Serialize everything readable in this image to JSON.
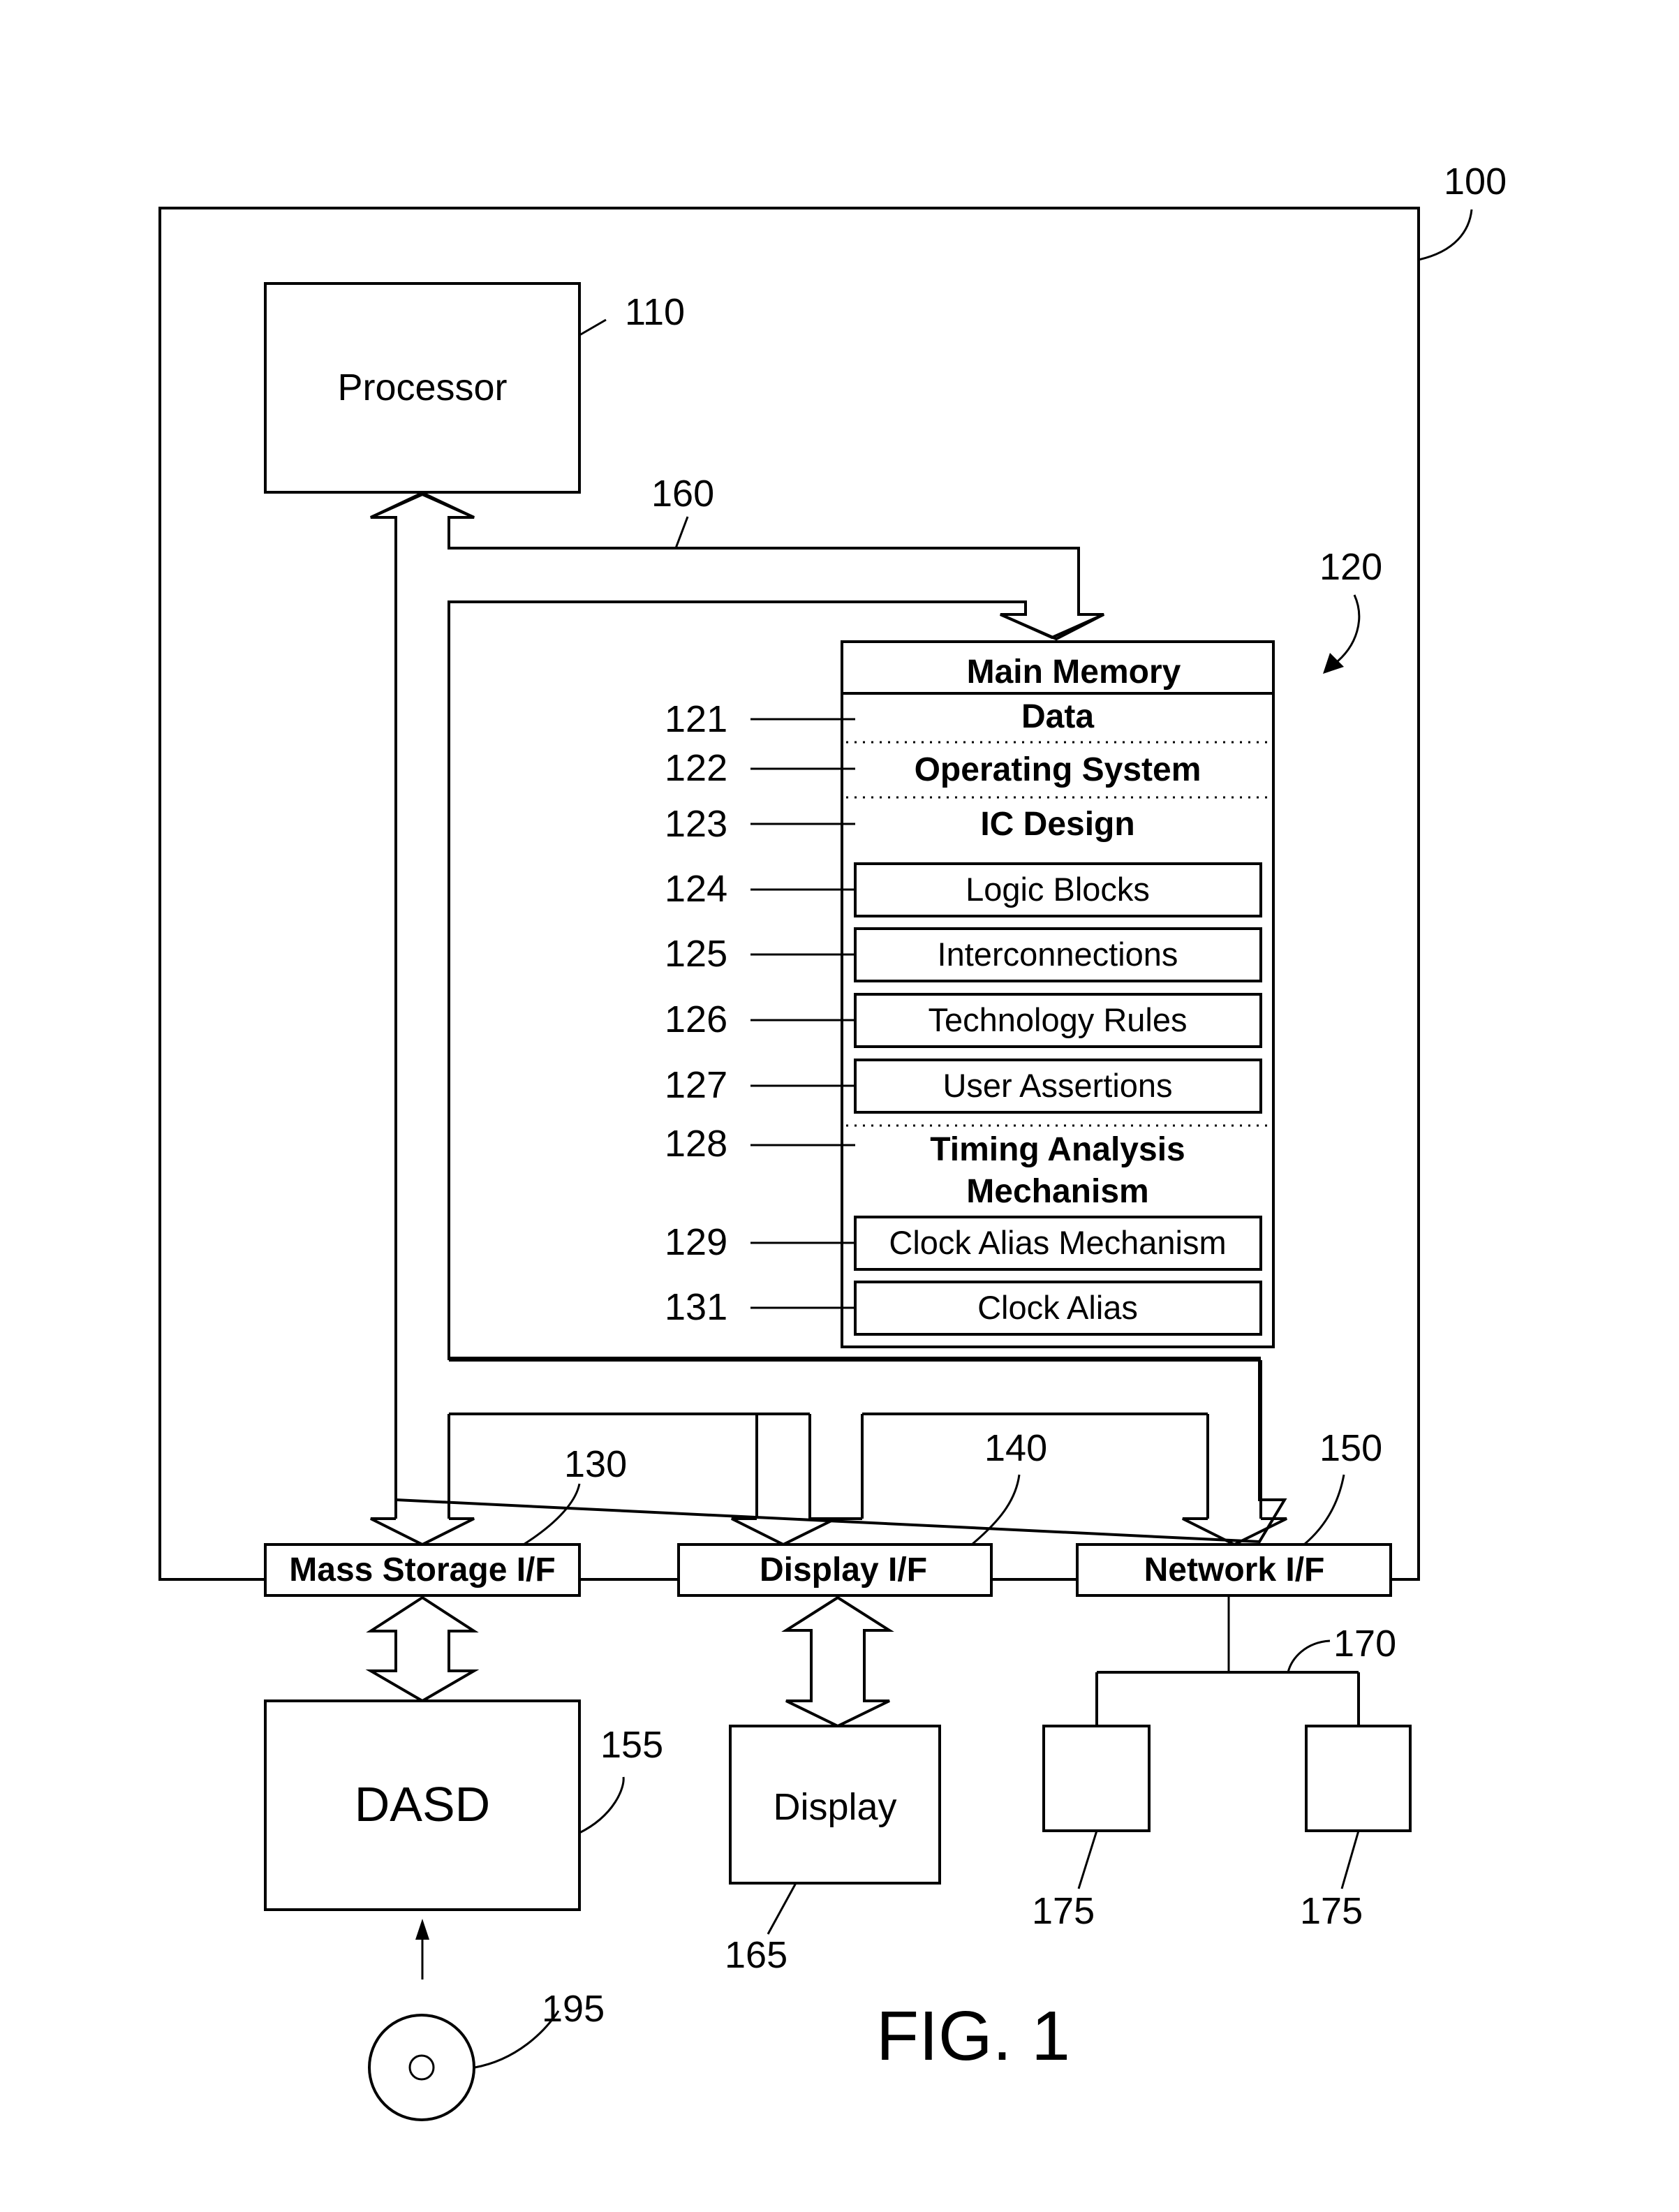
{
  "figure": {
    "caption": "FIG. 1",
    "system_ref": "100"
  },
  "processor": {
    "label": "Processor",
    "ref": "110"
  },
  "bus": {
    "ref": "160"
  },
  "main_memory": {
    "title": "Main Memory",
    "ref": "120",
    "sections": [
      {
        "ref": "121",
        "label": "Data",
        "style": "bold-section"
      },
      {
        "ref": "122",
        "label": "Operating System",
        "style": "bold-section"
      },
      {
        "ref": "123",
        "label": "IC Design",
        "style": "bold-section"
      },
      {
        "ref": "124",
        "label": "Logic Blocks",
        "style": "boxed-item"
      },
      {
        "ref": "125",
        "label": "Interconnections",
        "style": "boxed-item"
      },
      {
        "ref": "126",
        "label": "Technology Rules",
        "style": "boxed-item"
      },
      {
        "ref": "127",
        "label": "User Assertions",
        "style": "boxed-item"
      },
      {
        "ref": "128",
        "label_line1": "Timing Analysis",
        "label_line2": "Mechanism",
        "style": "bold-section"
      },
      {
        "ref": "129",
        "label": "Clock Alias Mechanism",
        "style": "boxed-item"
      },
      {
        "ref": "131",
        "label": "Clock Alias",
        "style": "boxed-item"
      }
    ]
  },
  "interfaces": [
    {
      "label": "Mass Storage I/F",
      "ref": "130"
    },
    {
      "label": "Display I/F",
      "ref": "140"
    },
    {
      "label": "Network I/F",
      "ref": "150"
    }
  ],
  "dasd": {
    "label": "DASD",
    "ref": "155"
  },
  "display": {
    "label": "Display",
    "ref": "165"
  },
  "network": {
    "ref": "170",
    "nodes": [
      {
        "ref": "175"
      },
      {
        "ref": "175"
      }
    ]
  },
  "media": {
    "ref": "195"
  }
}
